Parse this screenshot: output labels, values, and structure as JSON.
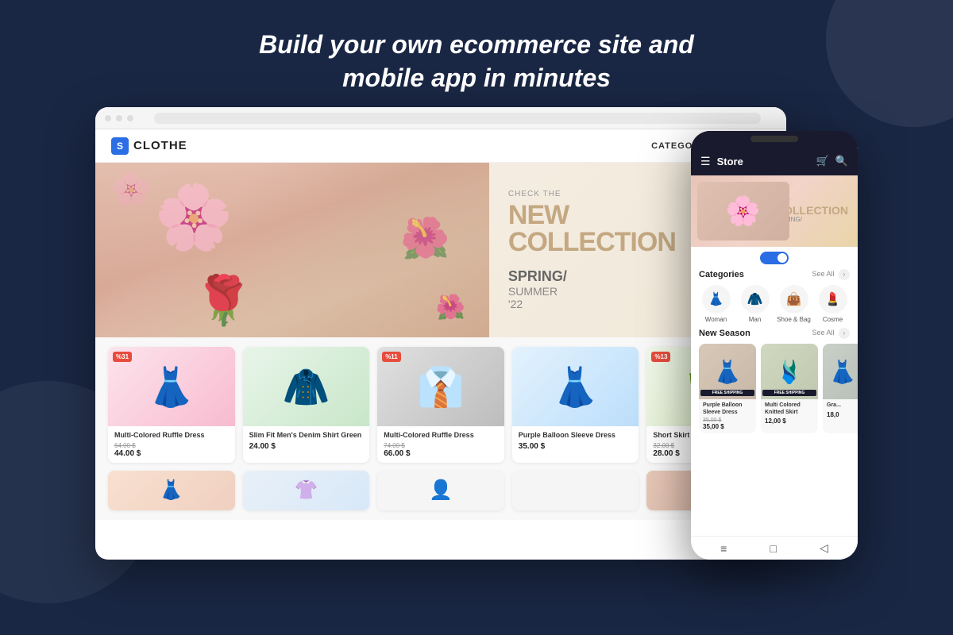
{
  "background_color": "#1a2744",
  "hero_headline_line1": "Build your own ecommerce site and",
  "hero_headline_line2": "mobile app in minutes",
  "desktop_site": {
    "logo_letter": "S",
    "logo_text": "CLOTHE",
    "nav_categories": "CATEGORIES",
    "hero_banner": {
      "check_the": "CHECK THE",
      "new_collection": "NEW\nCOLLECTION",
      "season_line1": "SPRING/",
      "season_line2": "SUMMER",
      "season_year": "'22"
    },
    "products": [
      {
        "name": "Multi-Colored Ruffle Dress",
        "old_price": "64.00 $",
        "price": "44.00 $",
        "discount": "31",
        "emoji": "👗",
        "bg": "pink"
      },
      {
        "name": "Slim Fit Men's Denim Shirt Green",
        "price": "24.00 $",
        "emoji": "🧥",
        "bg": "green"
      },
      {
        "name": "Multi-Colored Ruffle Dress",
        "old_price": "74.00 $",
        "price": "66.00 $",
        "discount": "11",
        "emoji": "👔",
        "bg": "dark"
      },
      {
        "name": "Purple Balloon Sleeve Dress",
        "price": "35.00 $",
        "emoji": "👗",
        "bg": "blue"
      },
      {
        "name": "Short Skirt Green Dress",
        "old_price": "32.00 $",
        "price": "28.00 $",
        "discount": "13",
        "emoji": "👗",
        "bg": "nature"
      }
    ]
  },
  "mobile_site": {
    "title": "Store",
    "hero": {
      "new_collection": "NEW\nCOLLECTION",
      "season": "SPRING/"
    },
    "categories_title": "Categories",
    "categories_see_all": "See All",
    "categories": [
      {
        "label": "Woman",
        "emoji": "👗"
      },
      {
        "label": "Man",
        "emoji": "🧥"
      },
      {
        "label": "Shoe & Bag",
        "emoji": "👜"
      },
      {
        "label": "Cosme",
        "emoji": "💄"
      }
    ],
    "new_season_title": "New Season",
    "new_season_see_all": "See All",
    "new_season_products": [
      {
        "name": "Purple Balloon Sleeve Dress",
        "old_price": "35,00 $",
        "price": "35,00 $",
        "free_shipping": true,
        "emoji": "👗",
        "bg": "#e0d0c8"
      },
      {
        "name": "Multi Colored Knitted Skirt",
        "price": "12,00 $",
        "free_shipping": true,
        "emoji": "🩱",
        "bg": "#d0d8c0"
      },
      {
        "name": "Gra...",
        "price": "18,0",
        "emoji": "👗",
        "bg": "#c8d0c8"
      }
    ],
    "bottom_nav": [
      "≡",
      "□",
      "◁"
    ]
  }
}
